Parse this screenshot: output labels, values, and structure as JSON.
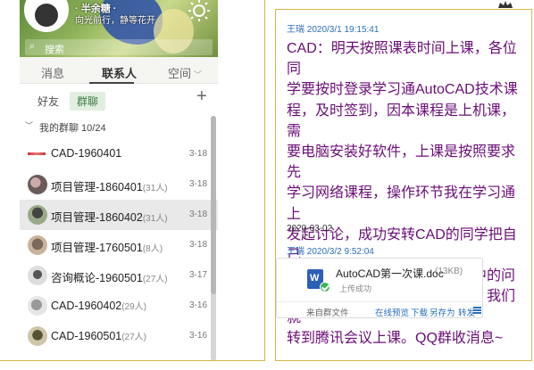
{
  "profile": {
    "name": "· 半余糖 ·",
    "signature": "向光前行，静等花开",
    "search_placeholder": "搜索"
  },
  "tabs": [
    {
      "label": "消息",
      "active": false
    },
    {
      "label": "联系人",
      "active": true
    },
    {
      "label": "空间",
      "active": false,
      "has_chevron": true
    }
  ],
  "subtabs": [
    {
      "label": "好友",
      "active": false
    },
    {
      "label": "群聊",
      "active": true
    }
  ],
  "add_icon": "plus-icon",
  "group_header": {
    "label": "我的群聊 10/24",
    "expanded": true
  },
  "groups": [
    {
      "name": "CAD-1960401",
      "count": "",
      "date": "3-18",
      "avatar": "logo",
      "selected": false
    },
    {
      "name": "项目管理-1860401",
      "count": "(31人)",
      "date": "3-18",
      "avatar": "p1",
      "selected": false
    },
    {
      "name": "项目管理-1860402",
      "count": "(31人)",
      "date": "3-18",
      "avatar": "p2",
      "selected": true
    },
    {
      "name": "项目管理-1760501",
      "count": "(8人)",
      "date": "3-18",
      "avatar": "p3",
      "selected": false
    },
    {
      "name": "咨询概论-1960501",
      "count": "(27人)",
      "date": "3-17",
      "avatar": "p4",
      "selected": false
    },
    {
      "name": "CAD-1960402",
      "count": "(29人)",
      "date": "3-16",
      "avatar": "p5",
      "selected": false
    },
    {
      "name": "CAD-1960501",
      "count": "(27人)",
      "date": "3-16",
      "avatar": "p6",
      "selected": false
    }
  ],
  "chat": {
    "message1": {
      "sender_time": "王瑞 2020/3/1 19:15:41",
      "lines": [
        "CAD：明天按照课表时间上课，各位同",
        "学要按时登录学习通AutoCAD技术课",
        "程，及时签到，因本课程是上机课，需",
        "要电脑安装好软件，上课是按照要求先",
        "学习网络课程，操作环节我在学习通上",
        "发起讨论，成功安转CAD的同学把自己",
        "电脑屏幕拍照上传，讲解操作中的问",
        "题。周一通常学习通可能卡住，我们就",
        "转到腾讯会议上课。QQ群收消息~"
      ],
      "color": "#6b0e78"
    },
    "date_separator": "2020-03-02",
    "message2": {
      "sender_time": "王瑞 2020/3/2 9:52:04",
      "file": {
        "name": "AutoCAD第一次课.doc",
        "size": "(13KB)",
        "status": "上传成功",
        "icon": "word-file-icon",
        "source": "来自群文件",
        "actions": [
          "在线预览",
          "下载",
          "另存为",
          "转发"
        ]
      }
    }
  },
  "colors": {
    "sender": "#2a6ebd",
    "frame": "#d9b64a",
    "selected_row": "#e9e9e9"
  }
}
